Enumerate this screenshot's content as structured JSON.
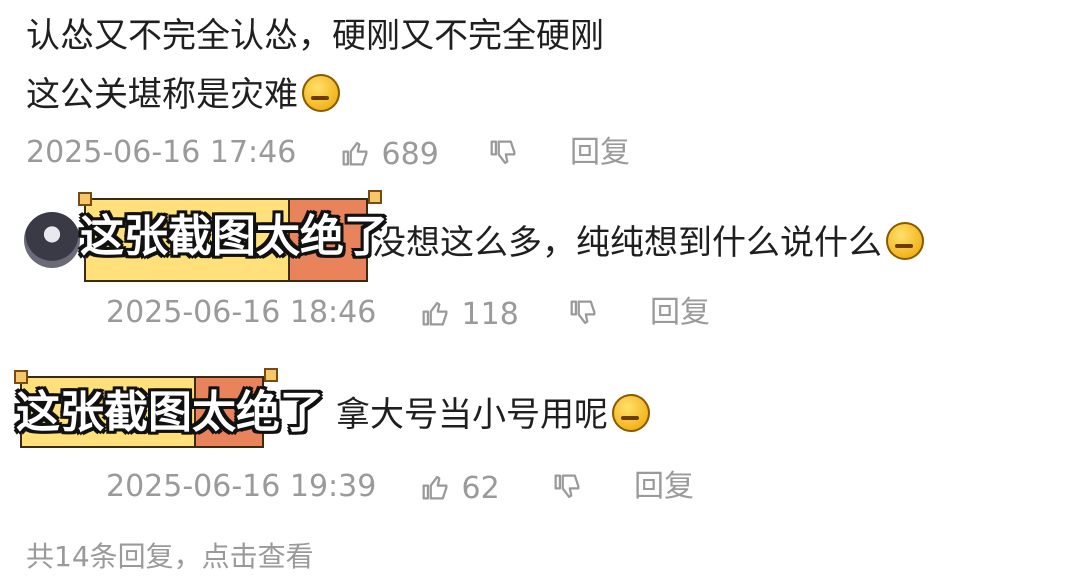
{
  "comment1": {
    "line1": "认怂又不完全认怂，硬刚又不完全硬刚",
    "line2": "这公关堪称是灾难",
    "emoji": "thinking-emoji",
    "time": "2025-06-16 17:46",
    "likes": "689",
    "reply": "回复"
  },
  "reply1": {
    "text_visible": "没想这么多，纯纯想到什么说什么",
    "emoji": "laughing-emoji",
    "time": "2025-06-16 18:46",
    "likes": "118",
    "reply": "回复"
  },
  "reply2": {
    "text_visible": "拿大号当小号用呢",
    "emoji": "laughing-emoji",
    "time": "2025-06-16 19:39",
    "likes": "62",
    "reply": "回复"
  },
  "caption": {
    "text": "这张截图太绝了"
  },
  "more_replies": "共14条回复，点击查看",
  "colors": {
    "highlight_yellow": "#ffe07a",
    "highlight_orange": "#e8835c",
    "meta_gray": "#9a9a9a"
  }
}
